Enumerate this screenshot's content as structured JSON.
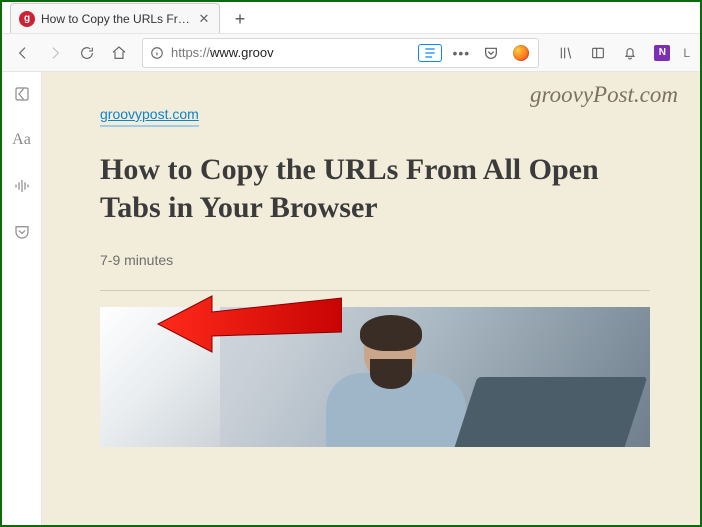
{
  "tab": {
    "favicon_letter": "g",
    "title": "How to Copy the URLs From All Open Tabs in Your Browser"
  },
  "url": {
    "protocol": "https://",
    "display": "www.groov"
  },
  "toolbar": {
    "profile_letter": "L"
  },
  "sidebar": {
    "aa": "Aa"
  },
  "reader": {
    "watermark": "groovyPost.com",
    "site_link": "groovypost.com",
    "title": "How to Copy the URLs From All Open Tabs in Your Browser",
    "read_time": "7-9 minutes"
  }
}
